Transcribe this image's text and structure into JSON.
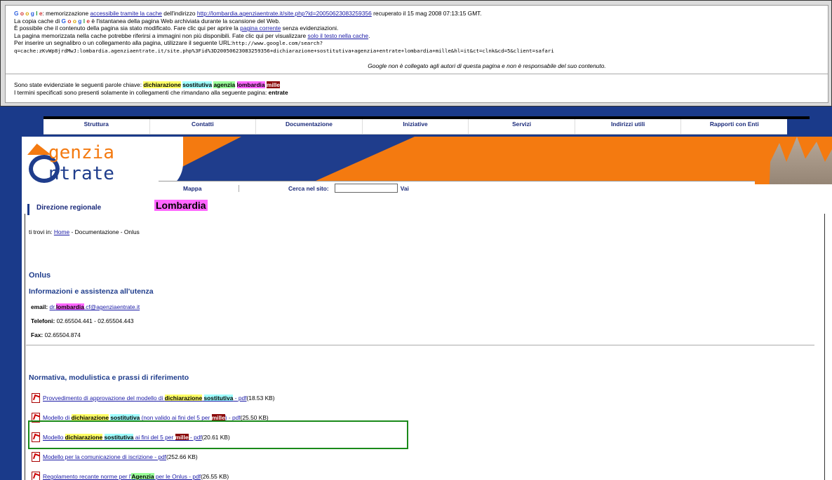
{
  "cache": {
    "google_word": "Google",
    "line1_pre": ": memorizzazione ",
    "line1_link": "accessibile tramite la cache",
    "line1_mid": " dell'indirizzo ",
    "line1_url": "http://lombardia.agenziaentrate.it/site.php?id=20050623083259356",
    "line1_post": " recuperato il 15 mag 2008 07:13:15 GMT.",
    "line2_pre": "La copia cache di ",
    "line2_post": " è l'istantanea della pagina Web archiviata durante la scansione del Web.",
    "line3_pre": "È possibile che il contenuto della pagina sia stato modificato. Fare clic qui per aprire la ",
    "line3_link": "pagina corrente",
    "line3_post": " senza evidenziazioni.",
    "line4_pre": "La pagina memorizzata nella cache potrebbe riferirsi a immagini non più disponibili. Fate clic qui per visualizzare ",
    "line4_link": "solo il testo nella cache",
    "line4_post": ".",
    "line5_pre": "Per inserire un segnalibro o un collegamento alla pagina, utilizzare il seguente URL:",
    "line5_url_a": "http://www.google.com/search?",
    "line5_url_b": "q=cache:zKvWp8jrdMwJ:lombardia.agenziaentrate.it/site.php%3Fid%3D20050623083259356+dichiarazione+sostitutiva+agenzia+entrate+lombardia+mille&hl=it&ct=clnk&cd=5&client=safari",
    "notice": "Google non è collegato agli autori di questa pagina e non è responsabile del suo contenuto.",
    "kw_pre": "Sono state evidenziate le seguenti parole chiave: ",
    "keywords": [
      "dichiarazione",
      "sostitutiva",
      "agenzia",
      "lombardia",
      "mille"
    ],
    "kw2_pre": "I termini specificati sono presenti solamente in collegamenti che rimandano alla seguente pagina: ",
    "kw2_term": "entrate"
  },
  "topnav": [
    "Struttura",
    "Contatti",
    "Documentazione",
    "Iniziative",
    "Servizi",
    "Indirizzi utili",
    "Rapporti con Enti"
  ],
  "logo": {
    "line1": "genzia",
    "line2": "ntrate"
  },
  "subnav": {
    "mappa": "Mappa",
    "cerca": "Cerca nel sito:",
    "vai": "Vai"
  },
  "region_tab": "Direzione regionale",
  "region_title": "Lombardia",
  "breadcrumb": {
    "pre": "ti trovi in: ",
    "home": "Home",
    "post": " - Documentazione - Onlus"
  },
  "page_title": "Onlus",
  "info_heading": "Informazioni e assistenza all'utenza",
  "email": {
    "label": "email:",
    "pre": "dr.",
    "hl": "lombardia",
    "post": ".cf@agenziaentrate.it"
  },
  "telefoni": {
    "label": "Telefoni:",
    "value": "02.65504.441 - 02.65504.443"
  },
  "fax": {
    "label": "Fax:",
    "value": "02.65504.874"
  },
  "norm_heading": "Normativa, modulistica e prassi di riferimento",
  "docs": [
    {
      "pre": "Provvedimento di approvazione del modello di ",
      "h1": "dichiarazione",
      "h2": "sostitutiva",
      "mid": "",
      "h3": "",
      "post": " - pdf",
      "size": " (18.53 KB)"
    },
    {
      "pre": "Modello di ",
      "h1": "dichiarazione",
      "h2": "sostitutiva",
      "mid": " (non valido ai fini del 5 per ",
      "h3": "mille",
      "post": ") - pdf",
      "size": " (25.50 KB)"
    },
    {
      "pre": "Modello ",
      "h1": "dichiarazione",
      "h2": "sostitutiva",
      "mid": " ai fini del 5 per ",
      "h3": "mille",
      "post": " - pdf",
      "size": " (20.61 KB)"
    },
    {
      "pre": "Modello per la comunicazione di iscrizione - pdf",
      "h1": "",
      "h2": "",
      "mid": "",
      "h3": "",
      "post": "",
      "size": " (252.66 KB)"
    },
    {
      "pre": "Regolamento recante norme per l'",
      "h1": "Agenzia",
      "h2": "",
      "mid": " per le Onlus - pdf",
      "h3": "",
      "post": "",
      "size": " (26.55 KB)"
    }
  ]
}
